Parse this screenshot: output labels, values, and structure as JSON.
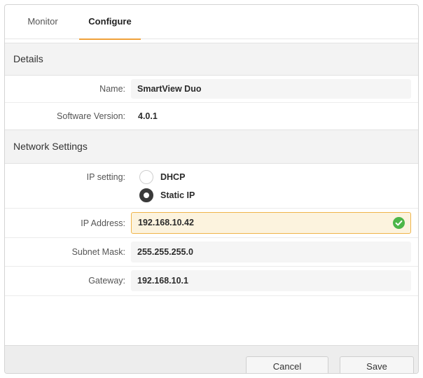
{
  "tabs": {
    "monitor": "Monitor",
    "configure": "Configure",
    "active": "configure"
  },
  "details": {
    "title": "Details",
    "name_label": "Name:",
    "name_value": "SmartView Duo",
    "software_label": "Software Version:",
    "software_value": "4.0.1"
  },
  "network": {
    "title": "Network Settings",
    "ip_setting_label": "IP setting:",
    "options": [
      {
        "label": "DHCP",
        "selected": false
      },
      {
        "label": "Static IP",
        "selected": true
      }
    ],
    "ip_address_label": "IP Address:",
    "ip_address_value": "192.168.10.42",
    "ip_address_valid": true,
    "subnet_label": "Subnet Mask:",
    "subnet_value": "255.255.255.0",
    "gateway_label": "Gateway:",
    "gateway_value": "192.168.10.1"
  },
  "footer": {
    "cancel": "Cancel",
    "save": "Save"
  },
  "colors": {
    "accent": "#f0a13a",
    "valid": "#4cb649",
    "focus_field_bg": "#fcf3de"
  },
  "icons": {
    "valid": "check-circle-icon"
  }
}
